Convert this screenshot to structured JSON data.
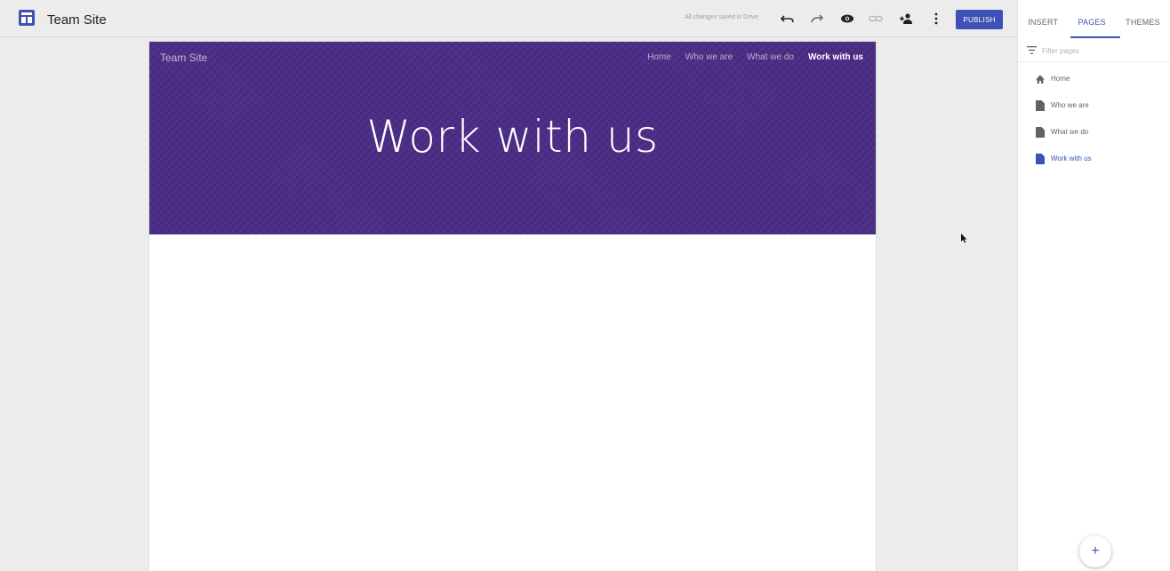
{
  "app": {
    "site_title": "Team Site",
    "save_status": "All changes saved in Drive",
    "publish_label": "PUBLISH"
  },
  "toolbar": {
    "icons": [
      "undo-icon",
      "redo-icon",
      "preview-icon",
      "link-icon",
      "share-icon",
      "more-vert-icon"
    ]
  },
  "hero": {
    "site_name": "Team Site",
    "nav": [
      {
        "label": "Home"
      },
      {
        "label": "Who we are"
      },
      {
        "label": "What we do"
      },
      {
        "label": "Work with us",
        "active": true
      }
    ],
    "title": "Work with us",
    "background_color": "#4b2d86"
  },
  "panel": {
    "tabs": [
      {
        "label": "INSERT"
      },
      {
        "label": "PAGES",
        "active": true
      },
      {
        "label": "THEMES"
      }
    ],
    "filter_placeholder": "Filter pages",
    "pages": [
      {
        "label": "Home",
        "icon": "home-icon"
      },
      {
        "label": "Who we are",
        "icon": "page-icon"
      },
      {
        "label": "What we do",
        "icon": "page-icon"
      },
      {
        "label": "Work with us",
        "icon": "page-icon",
        "active": true
      }
    ],
    "add_label": "+"
  },
  "colors": {
    "accent": "#3f51b5",
    "toolbar_bg": "#ececec"
  }
}
